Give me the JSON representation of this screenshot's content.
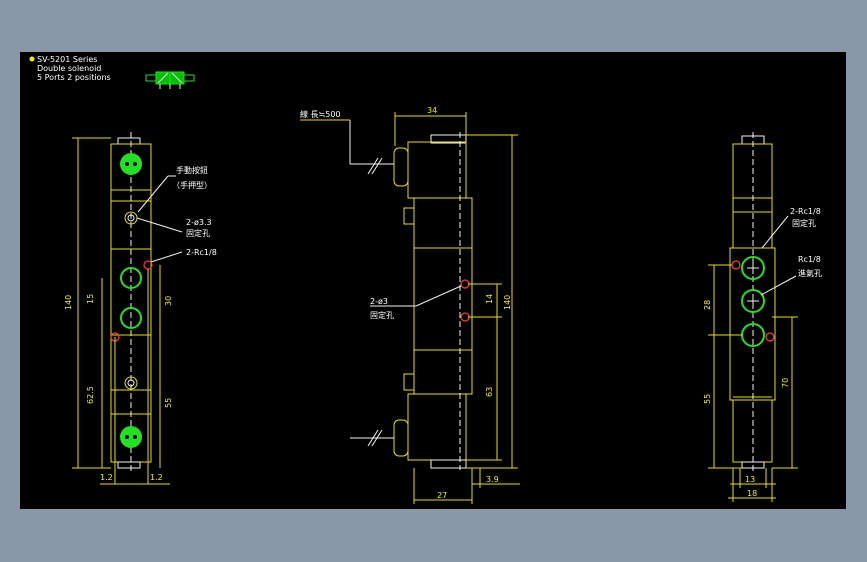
{
  "series_label": "SV-5201 Series",
  "subtitle_1": "Double solenoid",
  "subtitle_2": "5 Ports 2 positions",
  "labels": {
    "manual_button": "手動按鈕",
    "manual_type": "（手押型）",
    "fix_hole_33": "2-ø3.3",
    "fix_hole_33_cn": "固定孔",
    "port_rc18": "2-Rc1/8",
    "fix_hole_3": "2-ø3",
    "fix_hole_3_cn": "固定孔",
    "lead_wire": "線 長≒500",
    "rc18_right": "2-Rc1/8",
    "rc18_right_cn": "固定孔",
    "rc18_in": "Rc1/8",
    "rc18_in_cn": "進氣孔"
  },
  "dims": {
    "left": {
      "d140": "140",
      "d15": "15",
      "d30": "30",
      "d625": "62.5",
      "d55": "55",
      "d12a": "1.2",
      "d12b": "1.2"
    },
    "mid": {
      "d34": "34",
      "d14": "14",
      "d140": "140",
      "d63": "63",
      "d27": "27",
      "d39": "3.9"
    },
    "right": {
      "d28": "28",
      "d55": "55",
      "d70": "70",
      "d13": "13",
      "d18": "18"
    }
  },
  "colors": {
    "background": "#000000",
    "frame": "#8a97a8",
    "outline": "#e8e000",
    "port": "#22e022",
    "hole": "#ff3b3b",
    "text": "#ffffff"
  }
}
